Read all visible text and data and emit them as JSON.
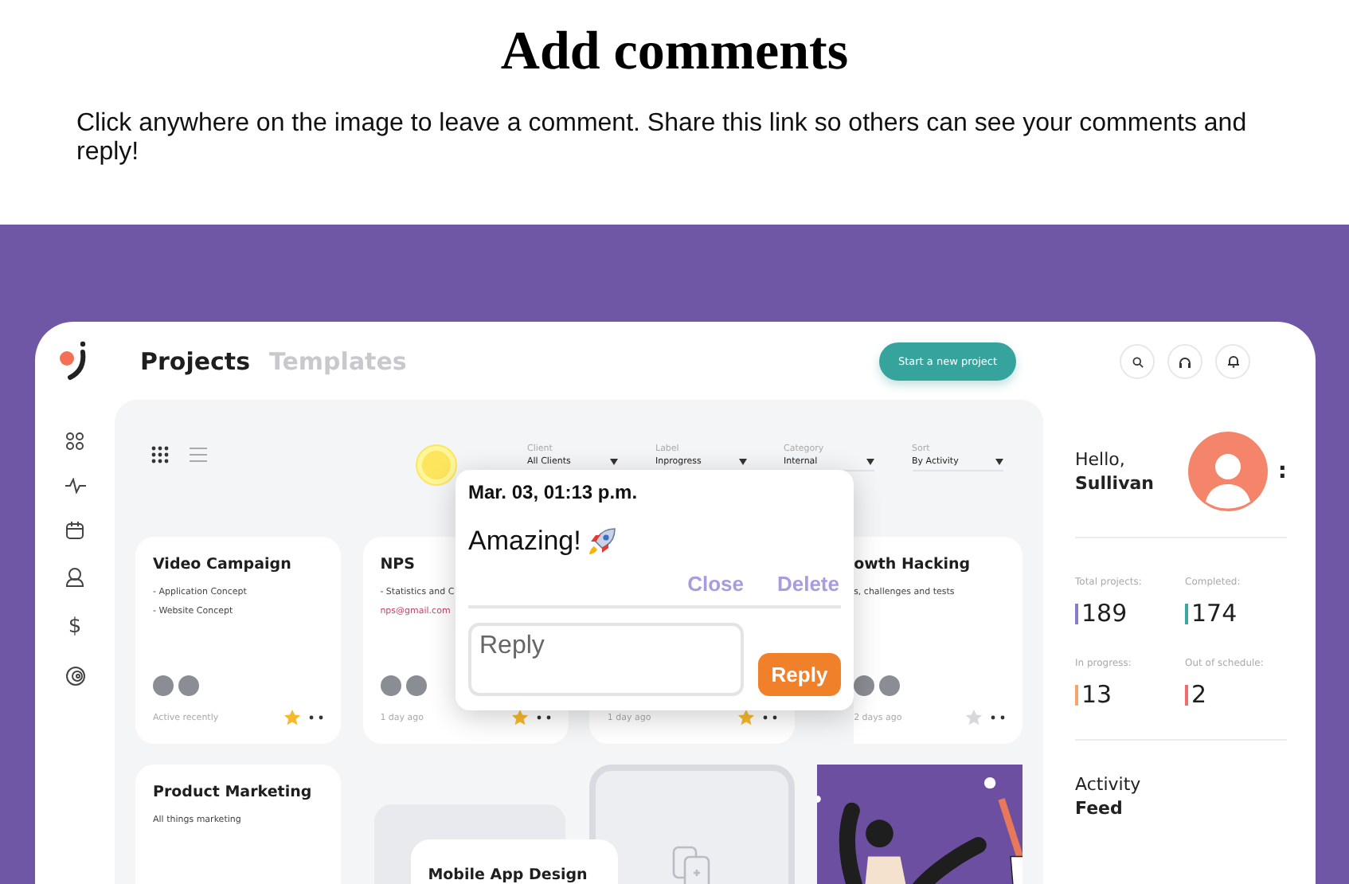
{
  "page": {
    "title": "Add comments",
    "intro": "Click anywhere on the image to leave a comment. Share this link so others can see your comments and reply!"
  },
  "app": {
    "tabs": [
      {
        "label": "Projects",
        "selected": true
      },
      {
        "label": "Templates",
        "selected": false
      }
    ],
    "new_project_button": "Start a new project",
    "sidebar_dollar": "$",
    "filters": [
      {
        "label": "Client",
        "value": "All Clients"
      },
      {
        "label": "Label",
        "value": "Inprogress"
      },
      {
        "label": "Category",
        "value": "Internal"
      },
      {
        "label": "Sort",
        "value": "By Activity"
      }
    ],
    "cards": [
      {
        "kind": "project",
        "title": "Video Campaign",
        "lines": [
          {
            "text": "- Application Concept",
            "link": false
          },
          {
            "text": "- Website Concept",
            "link": false
          }
        ],
        "avatars": [
          {
            "kind": "photo"
          },
          {
            "kind": "photo"
          }
        ],
        "time": "Active recently",
        "starred": true
      },
      {
        "kind": "project",
        "title": "NPS",
        "lines": [
          {
            "text": "- Statistics and C",
            "link": false
          },
          {
            "text": "nps@gmail.com",
            "link": true
          }
        ],
        "avatars": [
          {
            "kind": "photo"
          },
          {
            "kind": "photo"
          }
        ],
        "time": "1 day ago",
        "starred": true
      },
      {
        "kind": "project",
        "time": "1 day ago",
        "starred": true
      },
      {
        "kind": "project",
        "title": "owth Hacking",
        "lines": [
          {
            "text": "s, challenges and tests",
            "link": false
          }
        ],
        "avatars": [
          {
            "kind": "photo"
          },
          {
            "kind": "photo"
          }
        ],
        "time": "2 days ago",
        "starred": false
      },
      {
        "kind": "project",
        "title": "Product Marketing",
        "lines": [
          {
            "text": "All things marketing",
            "link": false
          }
        ]
      },
      {
        "kind": "stack",
        "title": "Mobile App Design"
      },
      {
        "kind": "add"
      },
      {
        "kind": "illustration"
      }
    ],
    "greeting": "Hello,",
    "user": "Sullivan",
    "more": ":",
    "stats": [
      {
        "label": "Total projects:",
        "value": "189",
        "color": "#8b79c9"
      },
      {
        "label": "Completed:",
        "value": "174",
        "color": "#3aa9a4"
      },
      {
        "label": "In progress:",
        "value": "13",
        "color": "#f3a56b"
      },
      {
        "label": "Out of schedule:",
        "value": "2",
        "color": "#ef6d6d"
      }
    ],
    "activity": "Activity",
    "feed": "Feed"
  },
  "comment": {
    "date": "Mar. 03, 01:13 p.m.",
    "text": "Amazing!",
    "actions": [
      "Close",
      "Delete"
    ],
    "reply_placeholder": "Reply",
    "reply_button": "Reply"
  }
}
